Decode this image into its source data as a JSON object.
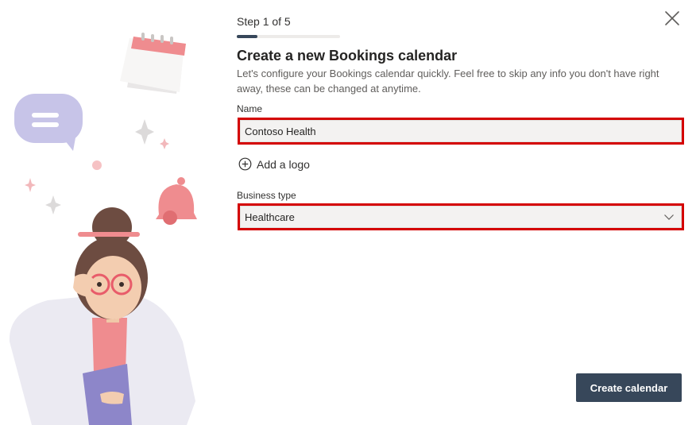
{
  "wizard": {
    "step_label": "Step 1 of 5",
    "progress_fraction": 0.2,
    "title": "Create a new Bookings calendar",
    "description": "Let's configure your Bookings calendar quickly. Feel free to skip any info you don't have right away, these can be changed at anytime."
  },
  "form": {
    "name_label": "Name",
    "name_value": "Contoso Health",
    "add_logo_label": "Add a logo",
    "business_type_label": "Business type",
    "business_type_value": "Healthcare"
  },
  "actions": {
    "create_label": "Create calendar"
  },
  "icons": {
    "close": "close-icon",
    "add": "add-circle-icon",
    "dropdown": "chevron-down-icon"
  },
  "colors": {
    "primary_button": "#37475a",
    "highlight_border": "#d40000",
    "field_background": "#f3f2f1"
  }
}
